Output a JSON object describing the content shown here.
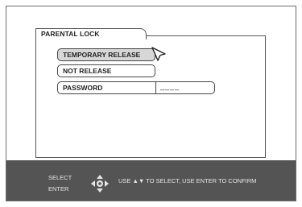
{
  "menu": {
    "title": "PARENTAL LOCK",
    "options": [
      {
        "label": "TEMPORARY RELEASE",
        "selected": true
      },
      {
        "label": "NOT RELEASE",
        "selected": false
      },
      {
        "label": "PASSWORD",
        "selected": false
      }
    ],
    "password_value": "____"
  },
  "footer": {
    "select_label": "SELECT",
    "enter_label": "ENTER",
    "instruction": "USE ▲▼ TO SELECT, USE ENTER TO CONFIRM"
  },
  "icons": {
    "cursor": "pointer-cursor-icon",
    "navigation": "joystick-icon"
  },
  "colors": {
    "selected_highlight": "#d7d7d7",
    "footer_bar": "#545454"
  }
}
